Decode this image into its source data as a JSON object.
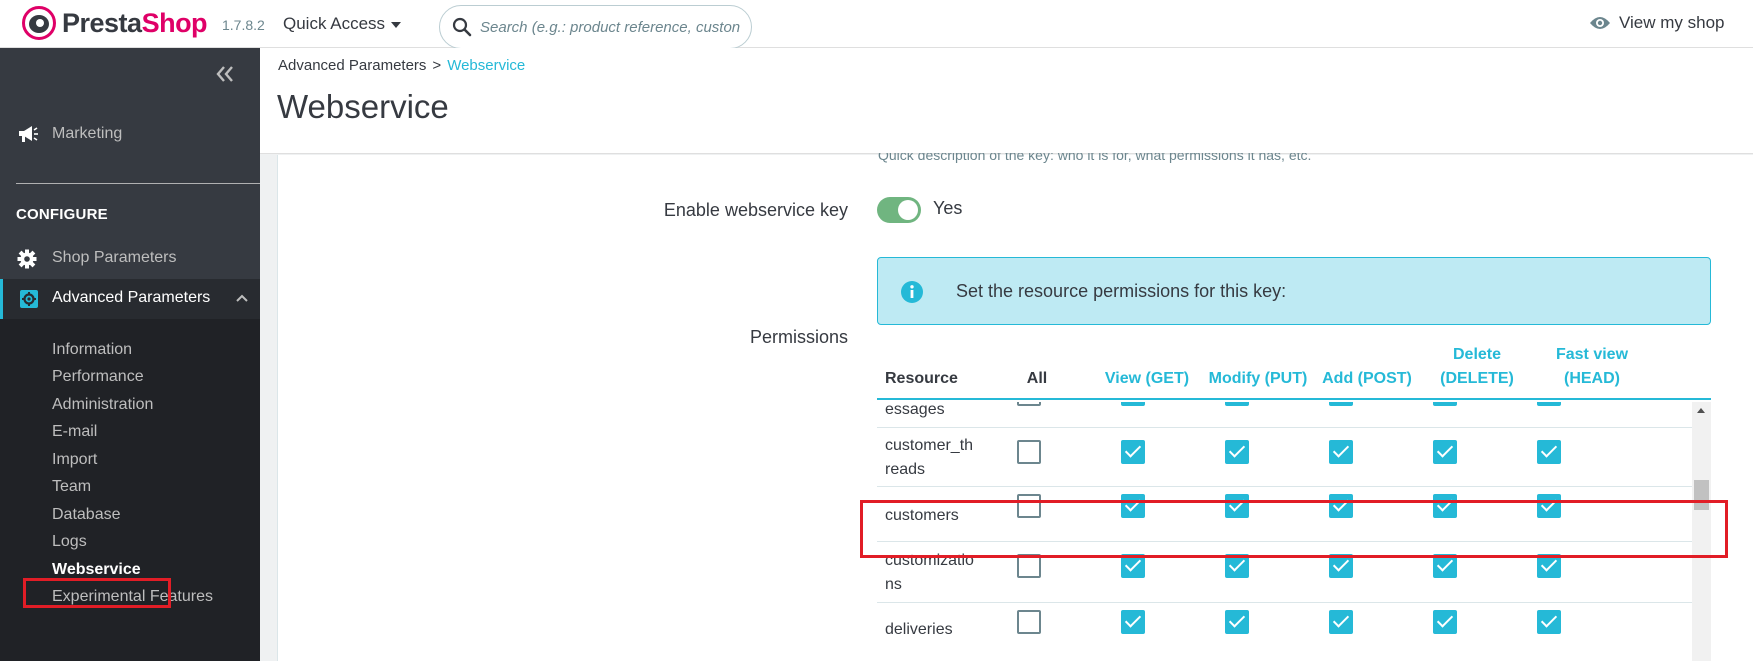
{
  "header": {
    "logo_text_a": "Presta",
    "logo_text_b": "Shop",
    "version": "1.7.8.2",
    "quick_access": "Quick Access",
    "search_placeholder": "Search (e.g.: product reference, custon",
    "view_shop": "View my shop"
  },
  "sidebar": {
    "marketing": "Marketing",
    "section": "CONFIGURE",
    "shop_parameters": "Shop Parameters",
    "advanced_parameters": "Advanced Parameters",
    "submenu": [
      "Information",
      "Performance",
      "Administration",
      "E-mail",
      "Import",
      "Team",
      "Database",
      "Logs",
      "Webservice",
      "Experimental Features"
    ],
    "active_item": "Webservice"
  },
  "page": {
    "breadcrumb_parent": "Advanced Parameters",
    "breadcrumb_sep": ">",
    "breadcrumb_current": "Webservice",
    "title": "Webservice"
  },
  "form": {
    "description_help": "Quick description of the key: who it is for, what permissions it has, etc.",
    "enable_label": "Enable webservice key",
    "enable_value": "Yes",
    "alert_text": "Set the resource permissions for this key:",
    "permissions_label": "Permissions"
  },
  "permissions_table": {
    "headers": {
      "resource": "Resource",
      "all": "All",
      "get": "View (GET)",
      "put": "Modify (PUT)",
      "post": "Add (POST)",
      "delete_a": "Delete",
      "delete_b": "(DELETE)",
      "head_a": "Fast view",
      "head_b": "(HEAD)"
    },
    "rows": [
      {
        "name_a": "essages",
        "name_b": ""
      },
      {
        "name_a": "customer_th",
        "name_b": "reads"
      },
      {
        "name_a": "customers",
        "name_b": ""
      },
      {
        "name_a": "customizatio",
        "name_b": "ns"
      },
      {
        "name_a": "deliveries",
        "name_b": ""
      }
    ]
  },
  "colors": {
    "accent": "#25b9d7",
    "sidebar_bg": "#363a41",
    "switch_on": "#70b580",
    "highlight": "#e11d26"
  }
}
